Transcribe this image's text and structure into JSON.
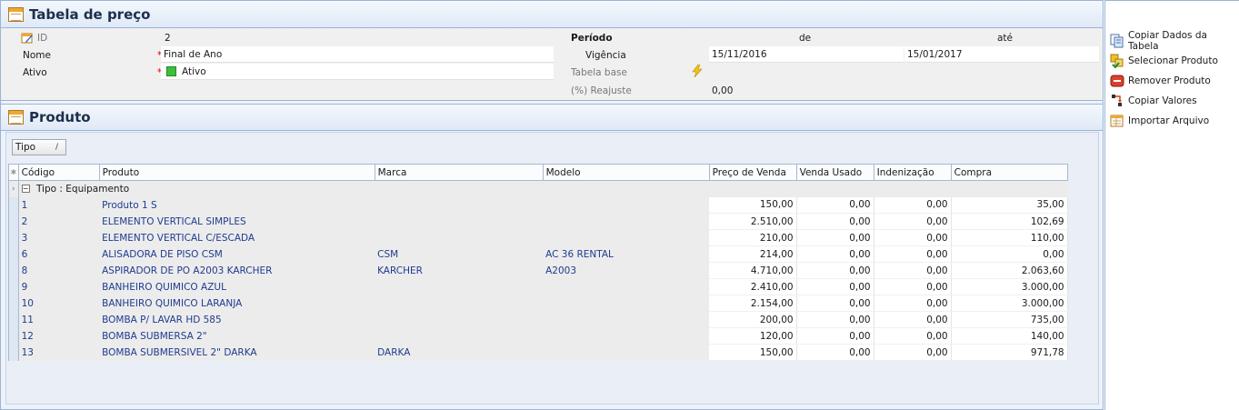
{
  "header": {
    "title": "Tabela de preço"
  },
  "form": {
    "id_label": "ID",
    "id_value": "2",
    "nome_label": "Nome",
    "nome_value": "Final de Ano",
    "ativo_label": "Ativo",
    "ativo_value": "Ativo",
    "periodo_label": "Período",
    "de_label": "de",
    "ate_label": "até",
    "vigencia_label": "Vigência",
    "vigencia_de": "15/11/2016",
    "vigencia_ate": "15/01/2017",
    "tabela_base_label": "Tabela base",
    "reajuste_label": "(%) Reajuste",
    "reajuste_value": "0,00",
    "required_mark": "*"
  },
  "produto": {
    "title": "Produto",
    "group_button": "Tipo",
    "group_sort_glyph": "/",
    "columns": [
      "Código",
      "Produto",
      "Marca",
      "Modelo",
      "Preço de Venda",
      "Venda Usado",
      "Indenização",
      "Compra"
    ],
    "group_label": "Tipo : Equipamento",
    "rows": [
      [
        "1",
        "Produto 1 S",
        "",
        "",
        "150,00",
        "0,00",
        "0,00",
        "35,00"
      ],
      [
        "2",
        "ELEMENTO VERTICAL SIMPLES",
        "",
        "",
        "2.510,00",
        "0,00",
        "0,00",
        "102,69"
      ],
      [
        "3",
        "ELEMENTO VERTICAL C/ESCADA",
        "",
        "",
        "210,00",
        "0,00",
        "0,00",
        "110,00"
      ],
      [
        "6",
        "ALISADORA DE PISO CSM",
        "CSM",
        "AC 36 RENTAL",
        "214,00",
        "0,00",
        "0,00",
        "0,00"
      ],
      [
        "8",
        "ASPIRADOR DE PO A2003 KARCHER",
        "KARCHER",
        "A2003",
        "4.710,00",
        "0,00",
        "0,00",
        "2.063,60"
      ],
      [
        "9",
        "BANHEIRO QUIMICO AZUL",
        "",
        "",
        "2.410,00",
        "0,00",
        "0,00",
        "3.000,00"
      ],
      [
        "10",
        "BANHEIRO QUIMICO LARANJA",
        "",
        "",
        "2.154,00",
        "0,00",
        "0,00",
        "3.000,00"
      ],
      [
        "11",
        "BOMBA P/ LAVAR HD 585",
        "",
        "",
        "200,00",
        "0,00",
        "0,00",
        "735,00"
      ],
      [
        "12",
        "BOMBA SUBMERSA 2\"",
        "",
        "",
        "120,00",
        "0,00",
        "0,00",
        "140,00"
      ],
      [
        "13",
        "BOMBA SUBMERSIVEL 2\" DARKA",
        "DARKA",
        "",
        "150,00",
        "0,00",
        "0,00",
        "971,78"
      ]
    ]
  },
  "actions": [
    {
      "label": "Copiar Dados da Tabela",
      "icon": "copy-table-icon"
    },
    {
      "label": "Selecionar Produto",
      "icon": "select-product-icon"
    },
    {
      "label": "Remover Produto",
      "icon": "remove-icon"
    },
    {
      "label": "Copiar Valores",
      "icon": "copy-values-icon"
    },
    {
      "label": "Importar Arquivo",
      "icon": "import-file-icon"
    }
  ],
  "colors": {
    "accent": "#1f3b8f",
    "header_bg": "#dfe9f6",
    "border": "#9ab4d6"
  }
}
